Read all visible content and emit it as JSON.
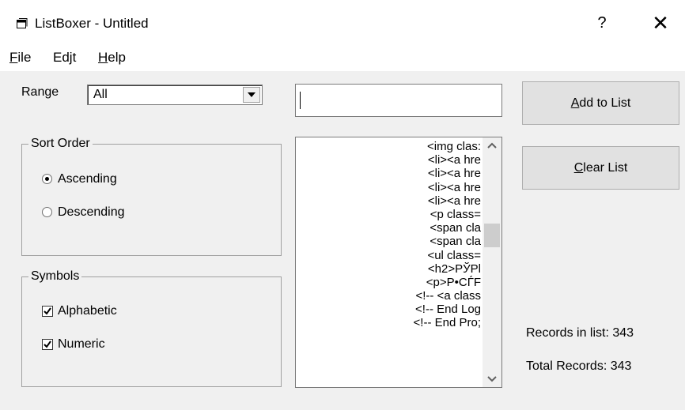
{
  "window": {
    "title": "ListBoxer - Untitled",
    "help_glyph": "?",
    "close_glyph": "✕",
    "icon": "app-window-icon"
  },
  "menu": {
    "file": {
      "pre": "",
      "accel": "F",
      "post": "ile"
    },
    "edit": {
      "pre": "Ed",
      "accel": "j",
      "post": "t"
    },
    "help": {
      "pre": "",
      "accel": "H",
      "post": "elp"
    }
  },
  "range": {
    "label": "Range",
    "value": "All",
    "arrow_icon": "chevron-down-icon"
  },
  "sort_order": {
    "title": "Sort Order",
    "options": [
      {
        "label": "Ascending",
        "selected": true
      },
      {
        "label": "Descending",
        "selected": false
      }
    ]
  },
  "symbols": {
    "title": "Symbols",
    "options": [
      {
        "label": "Alphabetic",
        "checked": true
      },
      {
        "label": "Numeric",
        "checked": true
      }
    ]
  },
  "add_input": {
    "value": ""
  },
  "list": {
    "items": [
      "<img clas:",
      "<li><a hre",
      "<li><a hre",
      "<li><a hre",
      "<li><a hre",
      "<p class=",
      "<span cla",
      "<span cla",
      "<ul class=",
      "<h2>PЎPl",
      "<p>P•CЃF",
      "<!-- <a class",
      "<!-- End Log",
      "<!-- End Pro;"
    ],
    "scroll_position": 0.36
  },
  "buttons": {
    "add": {
      "accel": "A",
      "post": "dd to List"
    },
    "clear": {
      "accel": "C",
      "post": "lear List"
    }
  },
  "stats": {
    "records_in_list": "Records in list: 343",
    "total_records": "Total Records: 343"
  },
  "colors": {
    "face": "#f0f0f0",
    "button": "#e1e1e1",
    "border": "#a0a0a0"
  }
}
